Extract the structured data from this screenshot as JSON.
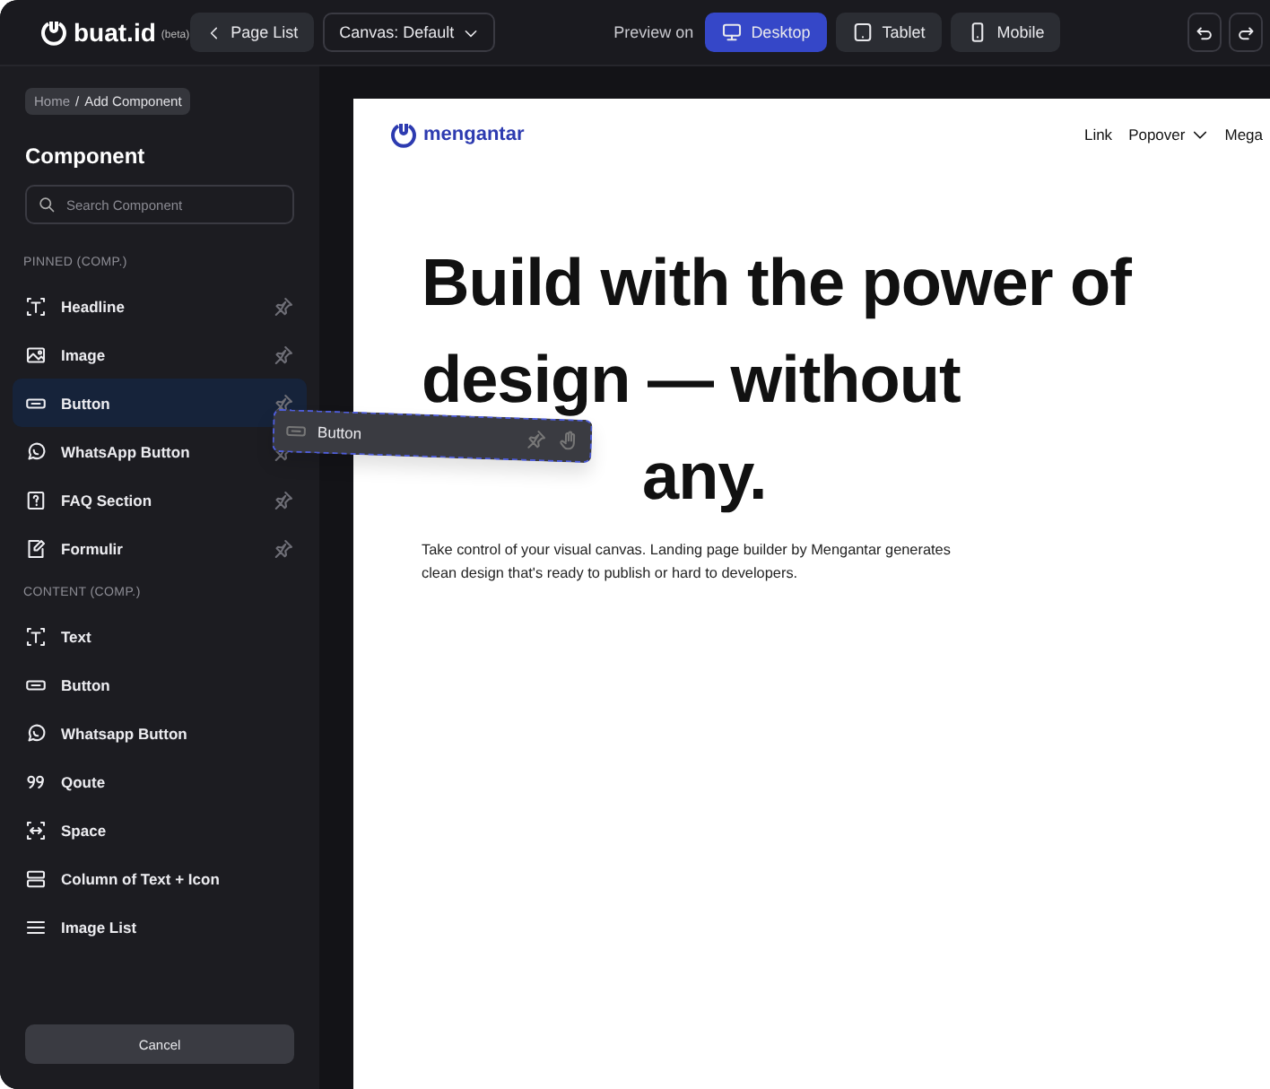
{
  "topbar": {
    "logo": "buat.id",
    "badge": "(beta)",
    "page_list": "Page List",
    "canvas_select": "Canvas: Default",
    "preview_label": "Preview on",
    "devices": [
      {
        "label": "Desktop",
        "kind": "desktop",
        "selected": true
      },
      {
        "label": "Tablet",
        "kind": "tablet",
        "selected": false
      },
      {
        "label": "Mobile",
        "kind": "mobile",
        "selected": false
      }
    ]
  },
  "sidebar": {
    "breadcrumb": {
      "items": [
        "Home",
        "Add Component"
      ],
      "separator": "/"
    },
    "title": "Component",
    "search": {
      "placeholder": "Search Component"
    },
    "sections": [
      {
        "heading": "PINNED (COMP.)",
        "pinned": true,
        "items": [
          {
            "label": "Headline",
            "kind": "headline",
            "selected": false
          },
          {
            "label": "Image",
            "kind": "image",
            "selected": false
          },
          {
            "label": "Button",
            "kind": "button",
            "selected": true
          },
          {
            "label": "WhatsApp Button",
            "kind": "whatsapp",
            "selected": false
          },
          {
            "label": "FAQ Section",
            "kind": "faq",
            "selected": false
          },
          {
            "label": "Formulir",
            "kind": "form",
            "selected": false
          }
        ]
      },
      {
        "heading": "CONTENT (COMP.)",
        "pinned": false,
        "items": [
          {
            "label": "Text",
            "kind": "headline",
            "selected": false
          },
          {
            "label": "Button",
            "kind": "button",
            "selected": false
          },
          {
            "label": "Whatsapp Button",
            "kind": "whatsapp",
            "selected": false
          },
          {
            "label": "Qoute",
            "kind": "quote",
            "selected": false
          },
          {
            "label": "Space",
            "kind": "space",
            "selected": false
          },
          {
            "label": "Column of Text + Icon",
            "kind": "columns",
            "selected": false
          },
          {
            "label": "Image List",
            "kind": "list",
            "selected": false
          }
        ]
      }
    ],
    "cancel": "Cancel"
  },
  "canvas": {
    "brand": "mengantar",
    "nav": [
      {
        "label": "Link",
        "dropdown": false
      },
      {
        "label": "Popover",
        "dropdown": true
      },
      {
        "label": "Mega",
        "dropdown": false
      }
    ],
    "headline": [
      "Build with the power of",
      "design — without",
      "any."
    ],
    "body": "Take control of your visual canvas. Landing page builder by Mengantar generates clean design that's ready to publish or hard to developers."
  },
  "drag_ghost": {
    "label": "Button",
    "kind": "button"
  }
}
